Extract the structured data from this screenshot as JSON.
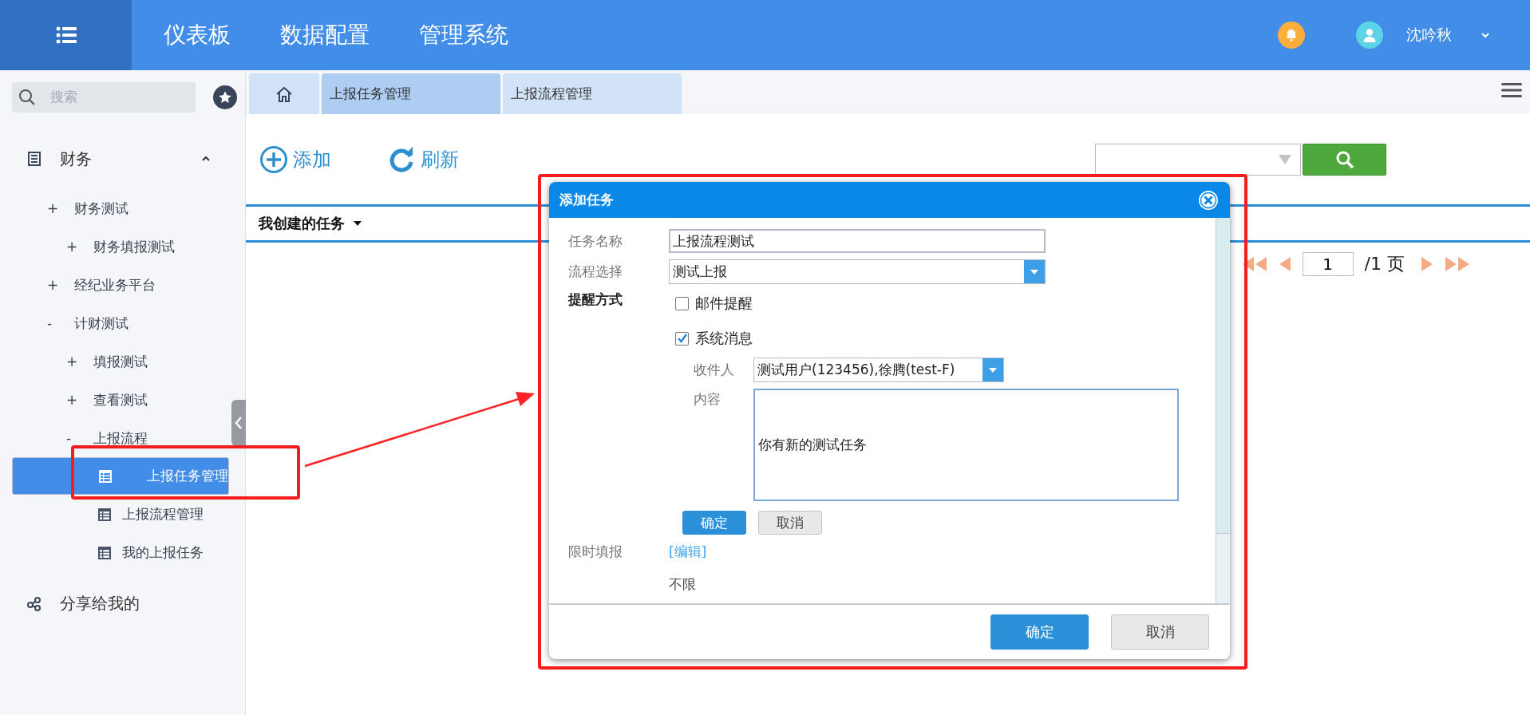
{
  "top_nav": {
    "items": [
      {
        "label": "仪表板"
      },
      {
        "label": "数据配置"
      },
      {
        "label": "管理系统"
      }
    ],
    "user": {
      "name": "沈吟秋"
    }
  },
  "sidebar": {
    "search": {
      "placeholder": "搜索"
    },
    "tree": [
      {
        "kind": "section",
        "label": "财务",
        "expanded": true,
        "children": [
          {
            "kind": "node",
            "sign": "+",
            "label": "财务测试",
            "children": [
              {
                "kind": "node",
                "sign": "+",
                "label": "财务填报测试"
              }
            ]
          },
          {
            "kind": "node",
            "sign": "+",
            "label": "经纪业务平台"
          },
          {
            "kind": "node",
            "sign": "-",
            "label": "计财测试",
            "children": [
              {
                "kind": "node",
                "sign": "+",
                "label": "填报测试"
              },
              {
                "kind": "node",
                "sign": "+",
                "label": "查看测试"
              },
              {
                "kind": "node",
                "sign": "-",
                "label": "上报流程",
                "children": [
                  {
                    "kind": "page",
                    "label": "上报任务管理",
                    "selected": true
                  },
                  {
                    "kind": "page",
                    "label": "上报流程管理",
                    "selected": false
                  },
                  {
                    "kind": "page",
                    "label": "我的上报任务",
                    "selected": false
                  }
                ]
              }
            ]
          }
        ]
      },
      {
        "kind": "link",
        "label": "分享给我的"
      }
    ]
  },
  "tabs": [
    {
      "kind": "home",
      "selected": false
    },
    {
      "kind": "page",
      "label": "上报任务管理",
      "selected": true
    },
    {
      "kind": "page",
      "label": "上报流程管理",
      "selected": false
    }
  ],
  "toolbar": {
    "actions": [
      {
        "kind": "add",
        "label": "添加"
      },
      {
        "kind": "refresh",
        "label": "刷新"
      }
    ]
  },
  "list": {
    "header": "我创建的任务",
    "pagination": {
      "page": "1",
      "total": "/1 页"
    }
  },
  "dialog": {
    "title": "添加任务",
    "task_name": {
      "label": "任务名称",
      "value": "上报流程测试"
    },
    "process": {
      "label": "流程选择",
      "value": "测试上报"
    },
    "reminder": {
      "label": "提醒方式",
      "options": [
        {
          "label": "邮件提醒",
          "checked": false
        },
        {
          "label": "系统消息",
          "checked": true
        }
      ]
    },
    "recipients": {
      "label": "收件人",
      "value": "测试用户(123456),徐腾(test-F)"
    },
    "content": {
      "label": "内容",
      "value": "你有新的测试任务"
    },
    "inline_buttons": [
      {
        "kind": "primary",
        "label": "确定"
      },
      {
        "kind": "secondary",
        "label": "取消"
      }
    ],
    "time_limit": {
      "label": "限时填报",
      "link": "[编辑]",
      "value": "不限"
    },
    "footer_buttons": [
      {
        "kind": "primary",
        "label": "确定"
      },
      {
        "kind": "secondary",
        "label": "取消"
      }
    ]
  }
}
